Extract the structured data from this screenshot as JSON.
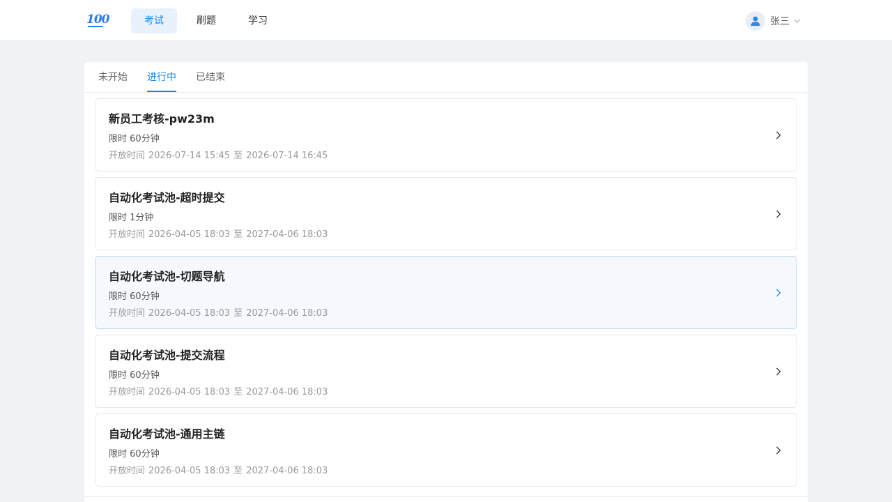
{
  "header": {
    "logo_text": "100",
    "nav": [
      {
        "label": "考试",
        "active": true
      },
      {
        "label": "刷题",
        "active": false
      },
      {
        "label": "学习",
        "active": false
      }
    ],
    "user": {
      "name": "张三",
      "avatar_icon": "user-icon",
      "menu_icon": "chevron-down-icon"
    }
  },
  "tabs": [
    {
      "label": "未开始",
      "active": false
    },
    {
      "label": "进行中",
      "active": true
    },
    {
      "label": "已结束",
      "active": false
    }
  ],
  "exams": [
    {
      "title": "新员工考核-pw23m",
      "limit_label": "限时",
      "limit": "60分钟",
      "time_label": "开放时间",
      "start": "2026-07-14 15:45",
      "to": "至",
      "end": "2026-07-14 16:45"
    },
    {
      "title": "自动化考试池-超时提交",
      "limit_label": "限时",
      "limit": "1分钟",
      "time_label": "开放时间",
      "start": "2026-04-05 18:03",
      "to": "至",
      "end": "2027-04-06 18:03"
    },
    {
      "title": "自动化考试池-切题导航",
      "limit_label": "限时",
      "limit": "60分钟",
      "time_label": "开放时间",
      "start": "2026-04-05 18:03",
      "to": "至",
      "end": "2027-04-06 18:03"
    },
    {
      "title": "自动化考试池-提交流程",
      "limit_label": "限时",
      "limit": "60分钟",
      "time_label": "开放时间",
      "start": "2026-04-05 18:03",
      "to": "至",
      "end": "2027-04-06 18:03"
    },
    {
      "title": "自动化考试池-通用主链",
      "limit_label": "限时",
      "limit": "60分钟",
      "time_label": "开放时间",
      "start": "2026-04-05 18:03",
      "to": "至",
      "end": "2027-04-06 18:03"
    }
  ],
  "colors": {
    "accent": "#1e88e5",
    "nav_active_bg": "#e8f2fd",
    "page_bg": "#f0f2f5",
    "hover_card_bg": "#f5f9fe"
  }
}
